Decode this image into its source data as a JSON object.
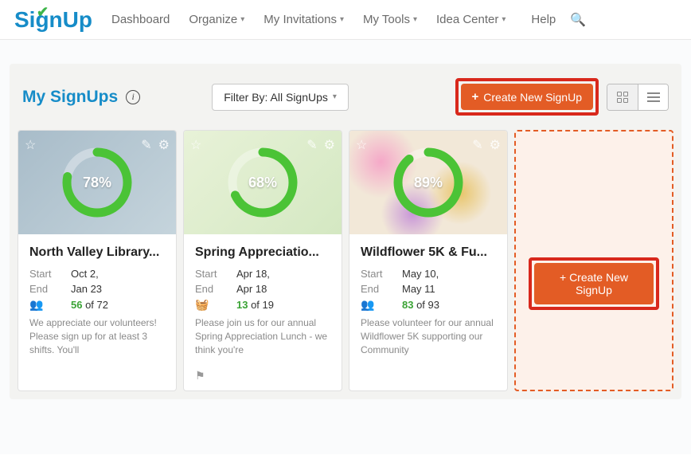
{
  "logo_text": "SignUp",
  "nav": {
    "dashboard": "Dashboard",
    "organize": "Organize",
    "invitations": "My Invitations",
    "tools": "My Tools",
    "idea": "Idea Center",
    "help": "Help"
  },
  "section_title": "My SignUps",
  "filter_label": "Filter By: All SignUps",
  "create_label": "Create New SignUp",
  "create_label2": "+ Create New SignUp",
  "cards": [
    {
      "title": "North Valley Library...",
      "pct": "78%",
      "pct_val": 78,
      "start_label": "Start",
      "start": "Oct 2,",
      "end_label": "End",
      "end": "Jan 23",
      "count": "56",
      "total": " of 72",
      "desc": "We appreciate our volunteers! Please sign up for at least 3 shifts. You'll",
      "icon": "people"
    },
    {
      "title": "Spring Appreciatio...",
      "pct": "68%",
      "pct_val": 68,
      "start_label": "Start",
      "start": "Apr 18,",
      "end_label": "End",
      "end": "Apr 18",
      "count": "13",
      "total": " of 19",
      "desc": "Please join us for our annual Spring Appreciation Lunch - we think you're",
      "icon": "basket"
    },
    {
      "title": "Wildflower 5K & Fu...",
      "pct": "89%",
      "pct_val": 89,
      "start_label": "Start",
      "start": "May 10,",
      "end_label": "End",
      "end": "May 11",
      "count": "83",
      "total": " of 93",
      "desc": "Please volunteer for our annual Wildflower 5K supporting our Community",
      "icon": "people"
    }
  ]
}
